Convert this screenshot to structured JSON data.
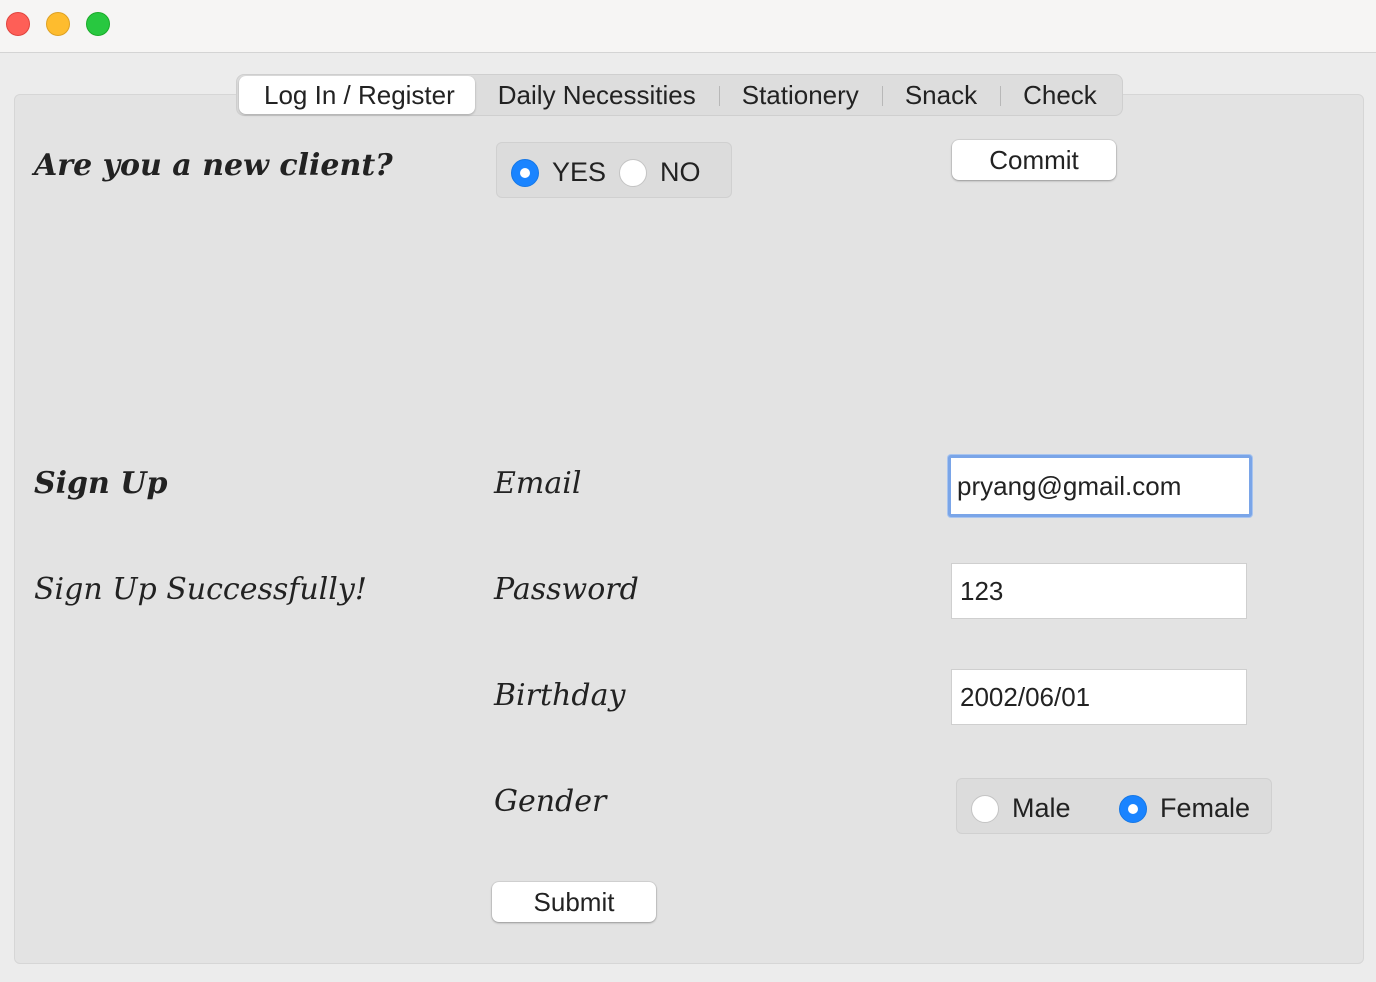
{
  "window": {
    "controls": [
      "close-icon",
      "minimize-icon",
      "zoom-icon"
    ]
  },
  "tabs": [
    {
      "label": "Log In / Register",
      "active": true
    },
    {
      "label": "Daily Necessities",
      "active": false
    },
    {
      "label": "Stationery",
      "active": false
    },
    {
      "label": "Snack",
      "active": false
    },
    {
      "label": "Check",
      "active": false
    }
  ],
  "client_question": {
    "label": "Are you a new client?",
    "options": [
      {
        "label": "YES",
        "selected": true
      },
      {
        "label": "NO",
        "selected": false
      }
    ],
    "commit_label": "Commit"
  },
  "signup": {
    "title": "Sign Up",
    "status": "Sign Up Successfully!",
    "email_label": "Email",
    "email_value": "pryang@gmail.com",
    "password_label": "Password",
    "password_value": "123",
    "birthday_label": "Birthday",
    "birthday_value": "2002/06/01",
    "gender_label": "Gender",
    "gender_options": [
      {
        "label": "Male",
        "selected": false
      },
      {
        "label": "Female",
        "selected": true
      }
    ],
    "submit_label": "Submit"
  },
  "colors": {
    "accent": "#1a84ff",
    "focus_ring": "#7aa5e8",
    "panel": "#e3e3e3"
  }
}
